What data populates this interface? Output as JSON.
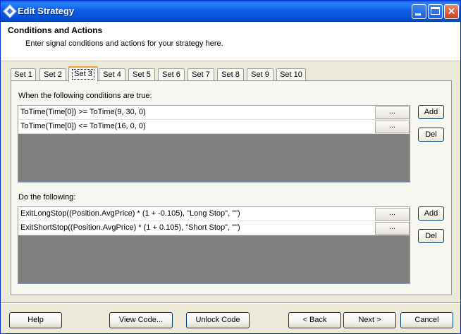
{
  "window": {
    "title": "Edit Strategy",
    "icon": "strategy-diamond-icon"
  },
  "header": {
    "title": "Conditions and Actions",
    "subtitle": "Enter signal conditions and actions for your strategy here."
  },
  "tabs": [
    {
      "label": "Set 1"
    },
    {
      "label": "Set 2"
    },
    {
      "label": "Set 3",
      "active": true
    },
    {
      "label": "Set 4"
    },
    {
      "label": "Set 5"
    },
    {
      "label": "Set 6"
    },
    {
      "label": "Set 7"
    },
    {
      "label": "Set 8"
    },
    {
      "label": "Set 9"
    },
    {
      "label": "Set 10"
    }
  ],
  "conditions": {
    "label": "When the following conditions are true:",
    "rows": [
      {
        "text": "ToTime(Time[0]) >= ToTime(9, 30, 0)",
        "button": "..."
      },
      {
        "text": "ToTime(Time[0]) <= ToTime(16, 0, 0)",
        "button": "..."
      }
    ],
    "add_label": "Add",
    "del_label": "Del"
  },
  "actions": {
    "label": "Do the following:",
    "rows": [
      {
        "text": "ExitLongStop((Position.AvgPrice) * (1 + -0.105), \"Long Stop\", \"\")",
        "button": "..."
      },
      {
        "text": "ExitShortStop((Position.AvgPrice) * (1 + 0.105), \"Short Stop\", \"\")",
        "button": "..."
      }
    ],
    "add_label": "Add",
    "del_label": "Del"
  },
  "footer": {
    "help": "Help",
    "view_code": "View Code...",
    "unlock_code": "Unlock Code",
    "back": "< Back",
    "next": "Next >",
    "cancel": "Cancel"
  },
  "colors": {
    "titlebar": "#0a5fe6",
    "tab_highlight": "#f0a030",
    "grid_background": "#808080",
    "dialog_face": "#ece9d8"
  }
}
